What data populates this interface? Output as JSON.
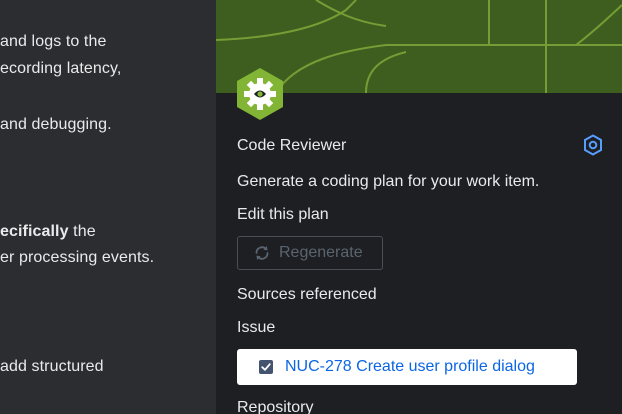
{
  "editor": {
    "lines": [
      "and logs to the",
      "ecording latency,",
      "and debugging.",
      "ecifically",
      " the",
      "er processing events.",
      "add structured"
    ]
  },
  "panel": {
    "agent_name": "Code Reviewer",
    "description": "Generate a coding plan for your work item.",
    "edit_plan_label": "Edit this plan",
    "regenerate_label": "Regenerate",
    "sources_heading": "Sources referenced",
    "issue_heading": "Issue",
    "issue_link": "NUC-278 Create user profile dialog",
    "repository_heading": "Repository"
  },
  "icons": {
    "settings": "settings-icon",
    "regenerate": "refresh-icon",
    "issue_type": "task-checkbox-icon",
    "agent": "agent-gear-eye-icon"
  },
  "colors": {
    "banner": "#3d5e1e",
    "avatar": "#82b536",
    "link": "#0c66e4",
    "settings_icon": "#579dff"
  }
}
